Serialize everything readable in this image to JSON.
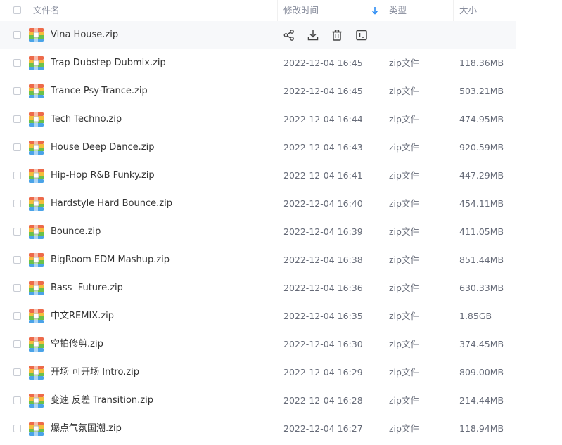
{
  "header": {
    "name": "文件名",
    "modified": "修改时间",
    "type": "类型",
    "size": "大小"
  },
  "colors": {
    "accent": "#2c8cf4",
    "row_hover": "#f7f8fa",
    "zip_icon": [
      "#ed6a4a",
      "#f5bd3c",
      "#6cc24a",
      "#4aa3e8"
    ]
  },
  "hover_actions": [
    "share-icon",
    "download-icon",
    "delete-icon",
    "more-icon"
  ],
  "files": [
    {
      "name": "Vina House.zip",
      "time": "",
      "type": "",
      "size": ""
    },
    {
      "name": "Trap Dubstep Dubmix.zip",
      "time": "2022-12-04 16:45",
      "type": "zip文件",
      "size": "118.36MB"
    },
    {
      "name": "Trance Psy-Trance.zip",
      "time": "2022-12-04 16:45",
      "type": "zip文件",
      "size": "503.21MB"
    },
    {
      "name": "Tech Techno.zip",
      "time": "2022-12-04 16:44",
      "type": "zip文件",
      "size": "474.95MB"
    },
    {
      "name": "House Deep Dance.zip",
      "time": "2022-12-04 16:43",
      "type": "zip文件",
      "size": "920.59MB"
    },
    {
      "name": "Hip-Hop R&B Funky.zip",
      "time": "2022-12-04 16:41",
      "type": "zip文件",
      "size": "447.29MB"
    },
    {
      "name": "Hardstyle Hard Bounce.zip",
      "time": "2022-12-04 16:40",
      "type": "zip文件",
      "size": "454.11MB"
    },
    {
      "name": "Bounce.zip",
      "time": "2022-12-04 16:39",
      "type": "zip文件",
      "size": "411.05MB"
    },
    {
      "name": "BigRoom EDM Mashup.zip",
      "time": "2022-12-04 16:38",
      "type": "zip文件",
      "size": "851.44MB"
    },
    {
      "name": "Bass  Future.zip",
      "time": "2022-12-04 16:36",
      "type": "zip文件",
      "size": "630.33MB"
    },
    {
      "name": "中文REMIX.zip",
      "time": "2022-12-04 16:35",
      "type": "zip文件",
      "size": "1.85GB"
    },
    {
      "name": "空拍修剪.zip",
      "time": "2022-12-04 16:30",
      "type": "zip文件",
      "size": "374.45MB"
    },
    {
      "name": "开场 可开场 Intro.zip",
      "time": "2022-12-04 16:29",
      "type": "zip文件",
      "size": "809.00MB"
    },
    {
      "name": "变速 反差 Transition.zip",
      "time": "2022-12-04 16:28",
      "type": "zip文件",
      "size": "214.44MB"
    },
    {
      "name": "爆点气氛国潮.zip",
      "time": "2022-12-04 16:27",
      "type": "zip文件",
      "size": "118.94MB"
    }
  ]
}
